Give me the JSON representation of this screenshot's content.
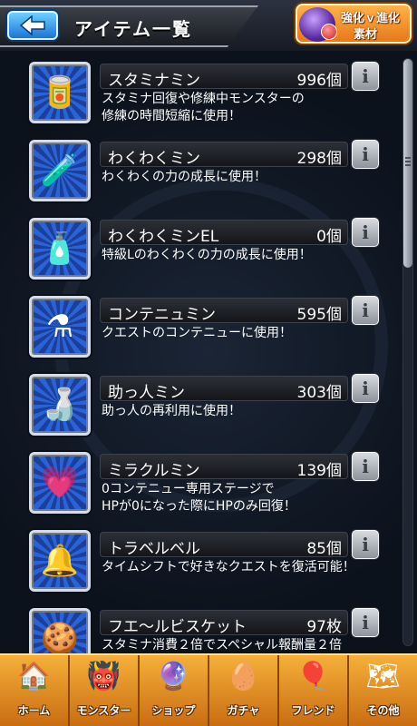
{
  "header": {
    "title": "アイテム一覧",
    "evo_line1": "強化ｖ進化",
    "evo_line2": "素材"
  },
  "items": [
    {
      "name": "スタミナミン",
      "count": "996個",
      "desc1": "スタミナ回復や修練中モンスターの",
      "desc2": "修練の時間短縮に使用！",
      "icon": "stamina-can-icon",
      "glyph": "🥫"
    },
    {
      "name": "わくわくミン",
      "count": "298個",
      "desc1": "わくわくの力の成長に使用！",
      "desc2": "",
      "icon": "green-bottle-icon",
      "glyph": "🧪"
    },
    {
      "name": "わくわくミンEL",
      "count": "0個",
      "desc1": "特級Lのわくわくの力の成長に使用！",
      "desc2": "",
      "icon": "blue-bottle-icon",
      "glyph": "🧴"
    },
    {
      "name": "コンテニュミン",
      "count": "595個",
      "desc1": "クエストのコンテニューに使用！",
      "desc2": "",
      "icon": "continue-bottle-icon",
      "glyph": "⚗"
    },
    {
      "name": "助っ人ミン",
      "count": "303個",
      "desc1": "助っ人の再利用に使用！",
      "desc2": "",
      "icon": "helper-bottle-icon",
      "glyph": "🍶"
    },
    {
      "name": "ミラクルミン",
      "count": "139個",
      "desc1": "0コンテニュー専用ステージで",
      "desc2": "HPが0になった際にHPのみ回復！",
      "icon": "heart-bottle-icon",
      "glyph": "💗"
    },
    {
      "name": "トラベルベル",
      "count": "85個",
      "desc1": "タイムシフトで好きなクエストを復活可能！",
      "desc2": "",
      "icon": "bell-icon",
      "glyph": "🔔"
    },
    {
      "name": "フエ～ルビスケット",
      "count": "97枚",
      "desc1": "スタミナ消費２倍でスペシャル報酬量２倍",
      "desc2": "",
      "icon": "biscuit-icon",
      "glyph": "🍪"
    }
  ],
  "nav": [
    {
      "label": "ホーム",
      "icon": "home-icon",
      "glyph": "🏠"
    },
    {
      "label": "モンスター",
      "icon": "monster-icon",
      "glyph": "👹"
    },
    {
      "label": "ショップ",
      "icon": "shop-orb-icon",
      "glyph": "🔮"
    },
    {
      "label": "ガチャ",
      "icon": "gacha-egg-icon",
      "glyph": "🥚"
    },
    {
      "label": "フレンド",
      "icon": "friend-balloons-icon",
      "glyph": "🎈"
    },
    {
      "label": "その他",
      "icon": "other-map-icon",
      "glyph": "🗺"
    }
  ]
}
